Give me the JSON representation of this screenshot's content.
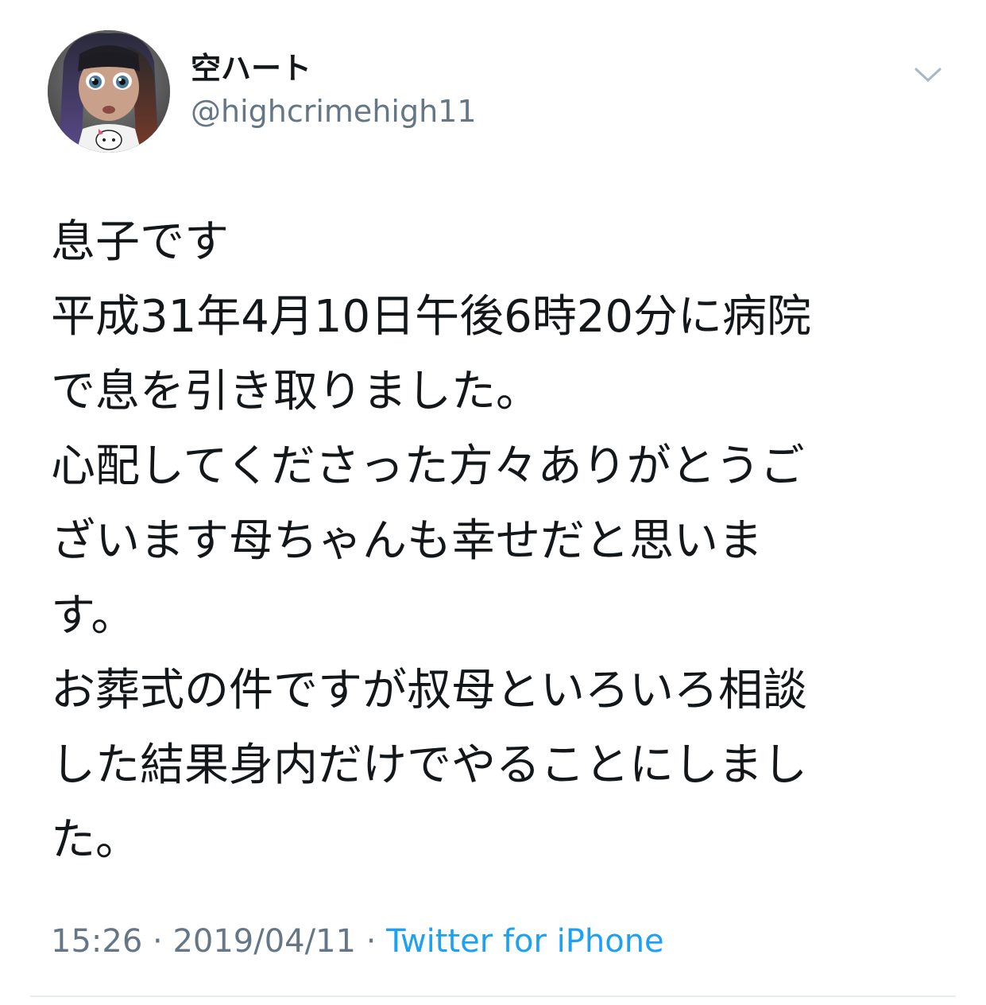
{
  "user": {
    "display_name": "空ハート",
    "handle": "@highcrimehigh11",
    "avatar_icon": "avatar-doll-image"
  },
  "header": {
    "more_icon": "chevron-down-icon"
  },
  "tweet": {
    "lines": [
      "息子です",
      "平成31年4月10日午後6時20分に病院",
      "で息を引き取りました。",
      "心配してくださった方々ありがとうご",
      "ざいます母ちゃんも幸せだと思いま",
      "す。",
      "お葬式の件ですが叔母といろいろ相談",
      "した結果身内だけでやることにしまし",
      "た。"
    ]
  },
  "meta": {
    "time": "15:26",
    "separator": " · ",
    "date": "2019/04/11",
    "source": "Twitter for iPhone"
  },
  "colors": {
    "text": "#14171a",
    "secondary": "#657786",
    "link": "#1da1f2",
    "divider": "#e6ecf0"
  }
}
